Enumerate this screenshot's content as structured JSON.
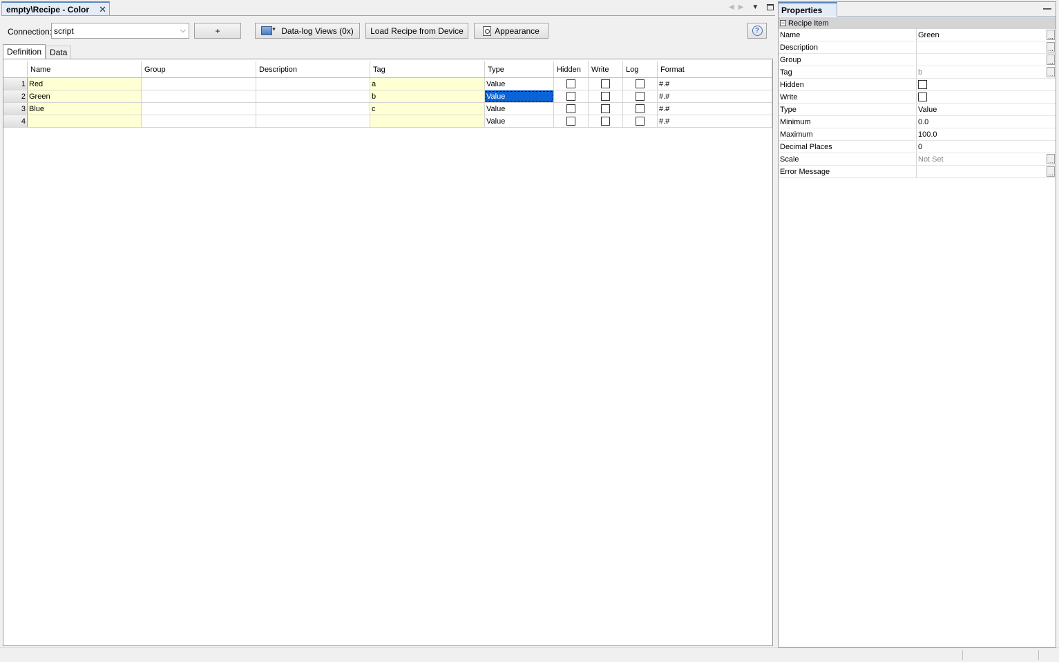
{
  "document_tab": {
    "title": "empty\\Recipe - Color",
    "close": "✕"
  },
  "toolbar": {
    "connection_label": "Connection:",
    "connection_value": "script",
    "add_label": "+",
    "datalog_label": "Data-log Views (0x)",
    "load_label": "Load Recipe from Device",
    "appearance_label": "Appearance",
    "help_label": "?"
  },
  "subtabs": [
    "Definition",
    "Data"
  ],
  "grid": {
    "columns": [
      "Name",
      "Group",
      "Description",
      "Tag",
      "Type",
      "Hidden",
      "Write",
      "Log",
      "Format"
    ],
    "rows": [
      {
        "num": "1",
        "name": "Red",
        "group": "",
        "description": "",
        "tag": "a",
        "type": "Value",
        "hidden": false,
        "write": false,
        "log": false,
        "format": "#.#"
      },
      {
        "num": "2",
        "name": "Green",
        "group": "",
        "description": "",
        "tag": "b",
        "type": "Value",
        "hidden": false,
        "write": false,
        "log": false,
        "format": "#.#"
      },
      {
        "num": "3",
        "name": "Blue",
        "group": "",
        "description": "",
        "tag": "c",
        "type": "Value",
        "hidden": false,
        "write": false,
        "log": false,
        "format": "#.#"
      },
      {
        "num": "4",
        "name": "",
        "group": "",
        "description": "",
        "tag": "",
        "type": "Value",
        "hidden": false,
        "write": false,
        "log": false,
        "format": "#.#"
      }
    ],
    "selected_row": 2,
    "selected_col": "Type"
  },
  "properties": {
    "title": "Properties",
    "minimize": "—",
    "category": "Recipe Item",
    "category_toggle": "−",
    "items": [
      {
        "key": "Name",
        "value": "Green",
        "ellipsis": true
      },
      {
        "key": "Description",
        "value": "",
        "ellipsis": true
      },
      {
        "key": "Group",
        "value": "",
        "ellipsis": true
      },
      {
        "key": "Tag",
        "value": "b",
        "ellipsis": true,
        "dim": true
      },
      {
        "key": "Hidden",
        "value": "",
        "checkbox": true
      },
      {
        "key": "Write",
        "value": "",
        "checkbox": true
      },
      {
        "key": "Type",
        "value": "Value"
      },
      {
        "key": "Minimum",
        "value": "0.0"
      },
      {
        "key": "Maximum",
        "value": "100.0"
      },
      {
        "key": "Decimal Places",
        "value": "0"
      },
      {
        "key": "Scale",
        "value": "Not Set",
        "ellipsis": true,
        "dim": true
      },
      {
        "key": "Error Message",
        "value": "",
        "ellipsis": true
      }
    ]
  },
  "colors": {
    "selection": "#0a64d8",
    "required_cell": "#ffffd4",
    "tab_accent": "#5c86b8"
  }
}
